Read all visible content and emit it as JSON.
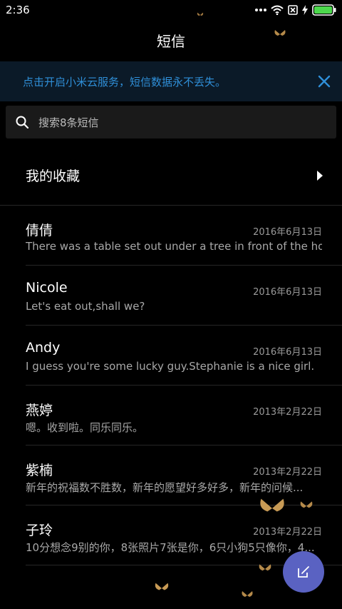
{
  "status_bar": {
    "time": "2:36",
    "icons": [
      "more-dots-icon",
      "wifi-icon",
      "sim-off-icon",
      "charging-icon",
      "battery-icon"
    ]
  },
  "header": {
    "title": "短信"
  },
  "banner": {
    "text": "点击开启小米云服务，短信数据永不丢失。",
    "close_icon": "close-icon",
    "accent_color": "#2f8fd8"
  },
  "search": {
    "placeholder": "搜索8条短信",
    "icon": "search-icon"
  },
  "favorites": {
    "label": "我的收藏",
    "icon": "chevron-right-icon"
  },
  "conversations": [
    {
      "name": "倩倩",
      "date": "2016年6月13日",
      "preview": "There was a table set out under a tree in front of the ho..."
    },
    {
      "name": "Nicole",
      "date": "2016年6月13日",
      "preview": "Let's eat out,shall we?"
    },
    {
      "name": "Andy",
      "date": "2016年6月13日",
      "preview": "I guess you're some lucky guy.Stephanie is a nice girl."
    },
    {
      "name": "燕婷",
      "date": "2013年2月22日",
      "preview": "嗯。收到啦。同乐同乐。"
    },
    {
      "name": "紫楠",
      "date": "2013年2月22日",
      "preview": "新年的祝福数不胜数，新年的愿望好多好多，新年的问候..."
    },
    {
      "name": "子玲",
      "date": "2013年2月22日",
      "preview": "10分想念9别的你，8张照片7张是你，6只小狗5只像你，4..."
    }
  ],
  "fab": {
    "icon": "compose-icon",
    "color": "#5a62c2"
  }
}
